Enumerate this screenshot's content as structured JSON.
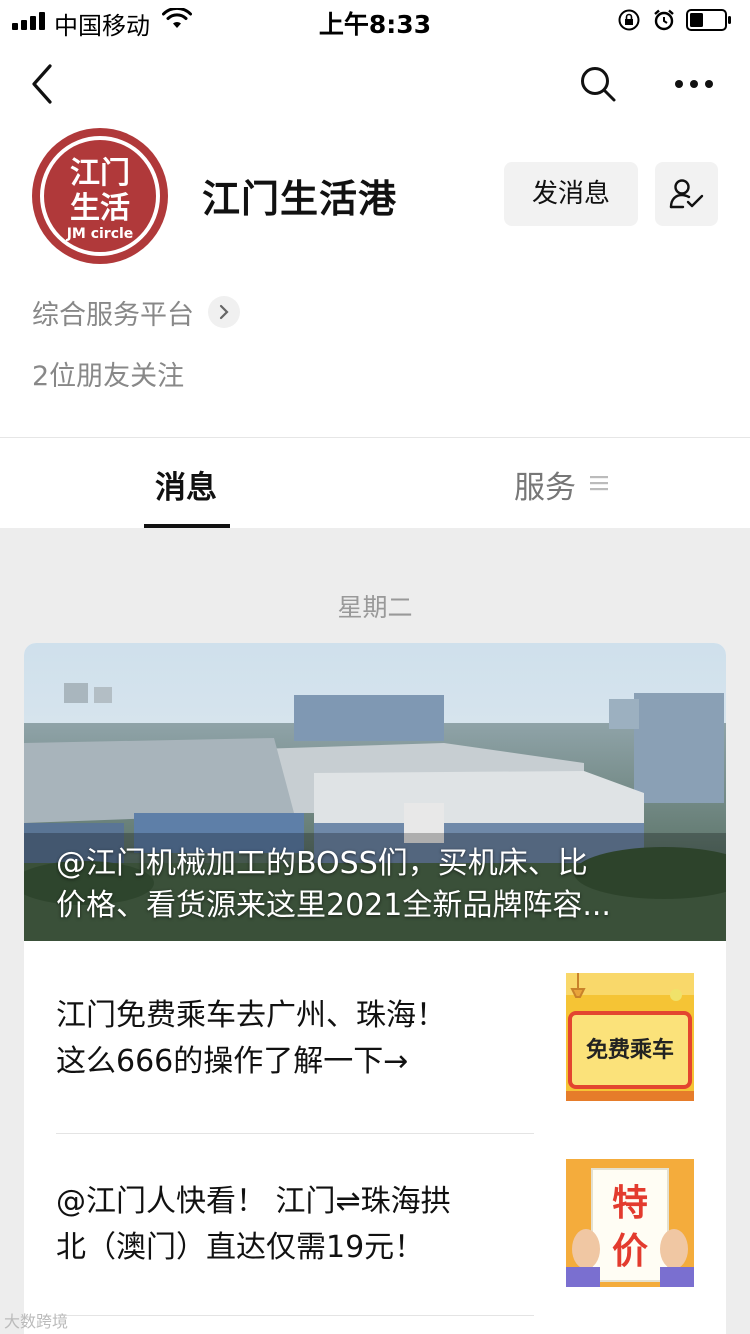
{
  "status_bar": {
    "carrier": "中国移动",
    "time": "上午8:33"
  },
  "account": {
    "name": "江门生活港",
    "avatar_text": [
      "江门",
      "生活",
      "JM circle"
    ],
    "message_button": "发消息",
    "category": "综合服务平台",
    "followers": "2位朋友关注"
  },
  "tabs": {
    "messages": "消息",
    "services": "服务"
  },
  "feed": {
    "date": "星期二",
    "cover_title_line1": "@江门机械加工的BOSS们，买机床、比",
    "cover_title_line2": "价格、看货源来这里2021全新品牌阵容...",
    "items": [
      {
        "line1": "江门免费乘车去广州、珠海！",
        "line2": "这么666的操作了解一下→",
        "thumb_text": "免费乘车"
      },
      {
        "line1": "@江门人快看！ 江门⇌珠海拱",
        "line2": "北（澳门）直达仅需19元！",
        "thumb_text": [
          "特",
          "价"
        ]
      }
    ]
  },
  "watermark": "大数跨境",
  "colors": {
    "avatar_red": "#b0393a",
    "accent_yellow": "#f5d23a",
    "thumb_orange": "#f3a53a"
  },
  "icons": [
    "signal-icon",
    "wifi-icon",
    "rotation-lock-icon",
    "alarm-icon",
    "battery-icon",
    "back-icon",
    "search-icon",
    "more-icon",
    "follow-check-icon",
    "chevron-right-icon",
    "menu-icon"
  ]
}
